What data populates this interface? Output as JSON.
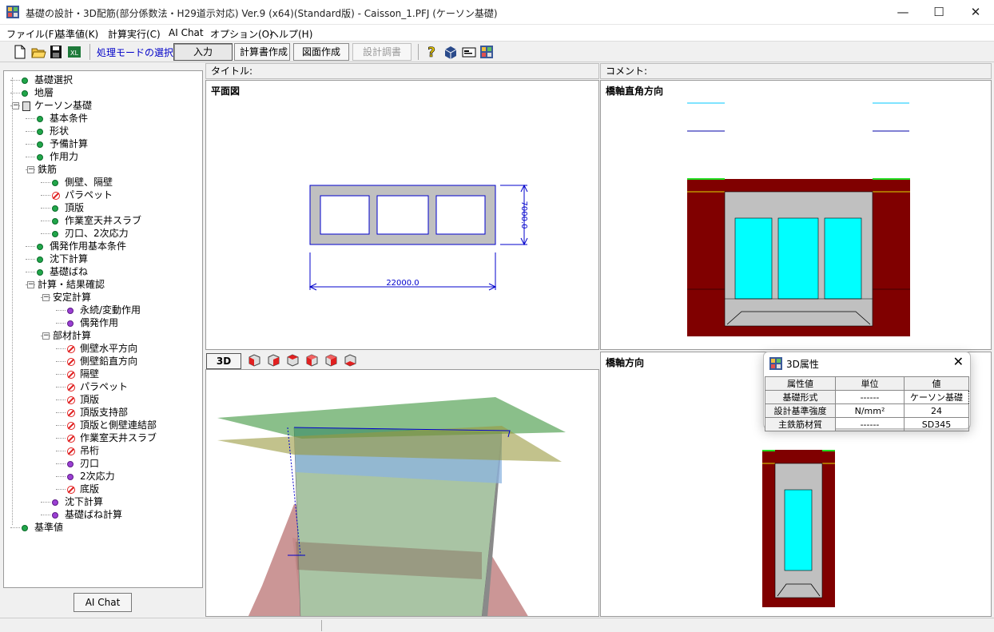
{
  "window": {
    "title": "基礎の設計・3D配筋(部分係数法・H29道示対応) Ver.9 (x64)(Standard版) - Caisson_1.PFJ (ケーソン基礎)",
    "controls": {
      "minimize": "—",
      "maximize": "☐",
      "close": "✕"
    }
  },
  "menu": [
    "ファイル(F)",
    "基準値(K)",
    "計算実行(C)",
    "AI Chat",
    "オプション(O)",
    "ヘルプ(H)"
  ],
  "toolbar": {
    "mode_label": "処理モードの選択",
    "input": "入力",
    "report": "計算書作成",
    "drawing": "図面作成",
    "design_record": "設計調書",
    "icons": [
      "new-file-icon",
      "open-folder-icon",
      "save-icon",
      "export-icon",
      "help-icon",
      "3d-model-icon",
      "card-icon",
      "app-icon"
    ]
  },
  "tree": [
    {
      "label": "基礎選択",
      "status": "green",
      "level": 0
    },
    {
      "label": "地層",
      "status": "green",
      "level": 0
    },
    {
      "label": "ケーソン基礎",
      "status": "root",
      "level": 0,
      "expanded": true
    },
    {
      "label": "基本条件",
      "status": "green",
      "level": 1
    },
    {
      "label": "形状",
      "status": "green",
      "level": 1
    },
    {
      "label": "予備計算",
      "status": "green",
      "level": 1
    },
    {
      "label": "作用力",
      "status": "green",
      "level": 1
    },
    {
      "label": "鉄筋",
      "status": "folder",
      "level": 1,
      "expanded": true
    },
    {
      "label": "側壁、隔壁",
      "status": "green",
      "level": 2
    },
    {
      "label": "パラペット",
      "status": "no",
      "level": 2
    },
    {
      "label": "頂版",
      "status": "green",
      "level": 2
    },
    {
      "label": "作業室天井スラブ",
      "status": "green",
      "level": 2
    },
    {
      "label": "刃口、2次応力",
      "status": "green",
      "level": 2
    },
    {
      "label": "偶発作用基本条件",
      "status": "green",
      "level": 1
    },
    {
      "label": "沈下計算",
      "status": "green",
      "level": 1
    },
    {
      "label": "基礎ばね",
      "status": "green",
      "level": 1
    },
    {
      "label": "計算・結果確認",
      "status": "folder",
      "level": 1,
      "expanded": true
    },
    {
      "label": "安定計算",
      "status": "folder",
      "level": 2,
      "expanded": true
    },
    {
      "label": "永続/変動作用",
      "status": "purple",
      "level": 3
    },
    {
      "label": "偶発作用",
      "status": "purple",
      "level": 3
    },
    {
      "label": "部材計算",
      "status": "folder",
      "level": 2,
      "expanded": true
    },
    {
      "label": "側壁水平方向",
      "status": "no",
      "level": 3
    },
    {
      "label": "側壁鉛直方向",
      "status": "no",
      "level": 3
    },
    {
      "label": "隔壁",
      "status": "no",
      "level": 3
    },
    {
      "label": "パラペット",
      "status": "no",
      "level": 3
    },
    {
      "label": "頂版",
      "status": "no",
      "level": 3
    },
    {
      "label": "頂版支持部",
      "status": "no",
      "level": 3
    },
    {
      "label": "頂版と側壁連結部",
      "status": "no",
      "level": 3
    },
    {
      "label": "作業室天井スラブ",
      "status": "no",
      "level": 3
    },
    {
      "label": "吊桁",
      "status": "no",
      "level": 3
    },
    {
      "label": "刃口",
      "status": "purple",
      "level": 3
    },
    {
      "label": "2次応力",
      "status": "purple",
      "level": 3
    },
    {
      "label": "底版",
      "status": "no",
      "level": 3
    },
    {
      "label": "沈下計算",
      "status": "purple",
      "level": 2
    },
    {
      "label": "基礎ばね計算",
      "status": "purple",
      "level": 2
    },
    {
      "label": "基準値",
      "status": "green",
      "level": 0
    }
  ],
  "ai_chat_button": "AI Chat",
  "headers": {
    "title": "タイトル:",
    "comment": "コメント:"
  },
  "views": {
    "plan": "平面図",
    "perp": "橋軸直角方向",
    "bridge": "橋軸方向",
    "threed_button": "3D",
    "dims": {
      "width": "22000.0",
      "depth": "7000.0"
    }
  },
  "popup": {
    "title": "3D属性",
    "headers": [
      "属性値",
      "単位",
      "値"
    ],
    "rows": [
      {
        "name": "基礎形式",
        "unit": "------",
        "value": "ケーソン基礎"
      },
      {
        "name": "設計基準強度",
        "unit": "N/mm²",
        "value": "24"
      },
      {
        "name": "主鉄筋材質",
        "unit": "------",
        "value": "SD345"
      }
    ]
  },
  "colors": {
    "soil": "#800000",
    "water": "#00ffff",
    "concrete": "#c0c0c0",
    "dim": "#0000cc"
  }
}
